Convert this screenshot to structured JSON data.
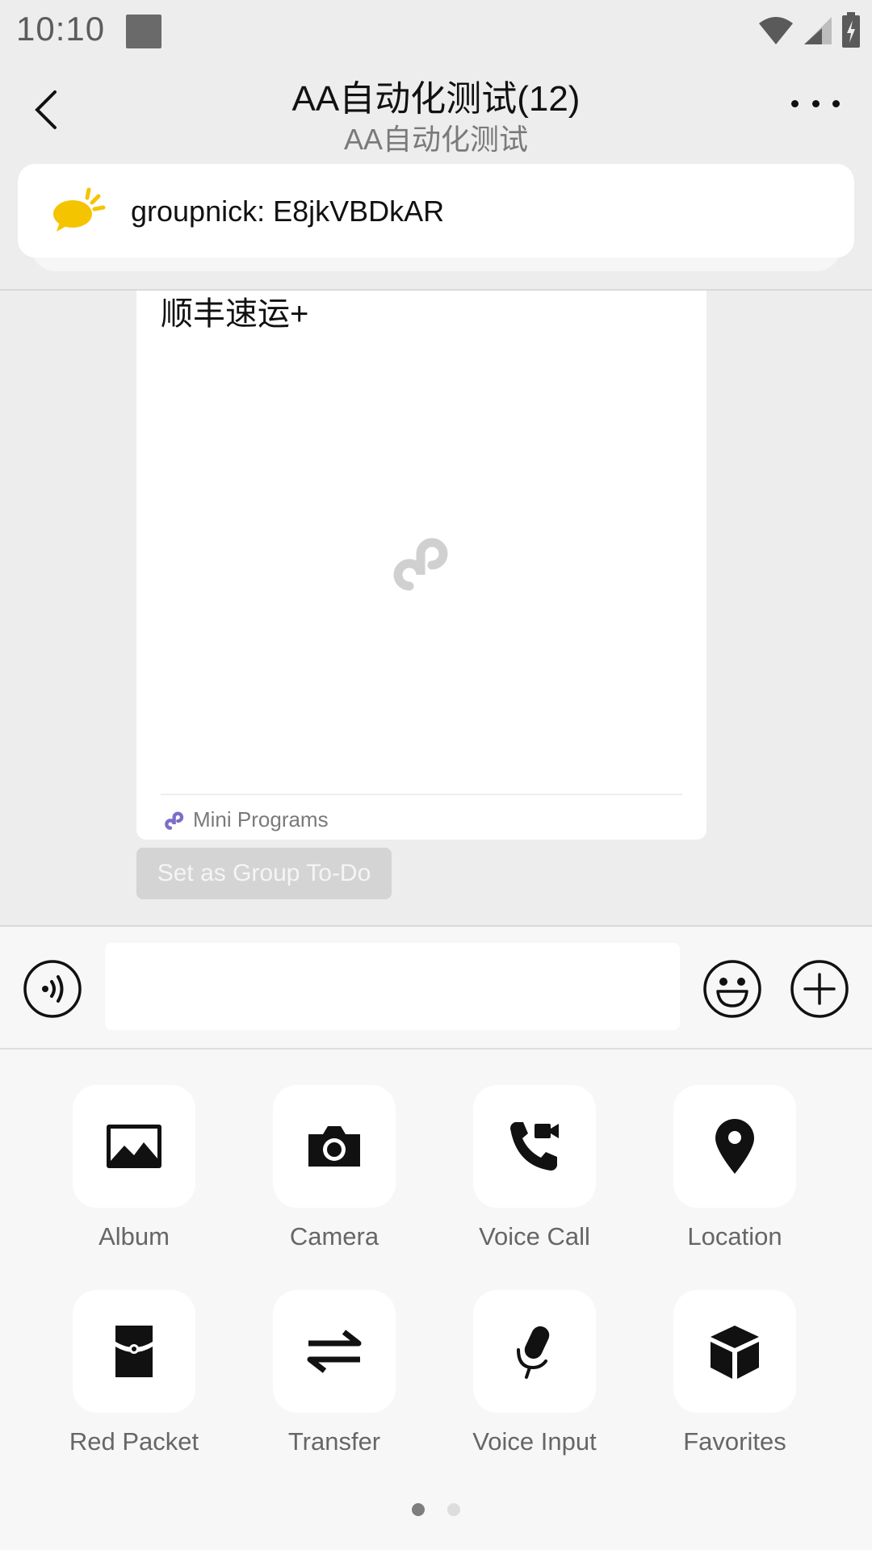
{
  "status_bar": {
    "time": "10:10"
  },
  "header": {
    "title": "AA自动化测试(12)",
    "subtitle": "AA自动化测试"
  },
  "announcement": {
    "text": "groupnick: E8jkVBDkAR"
  },
  "message_card": {
    "title": "顺丰速运+",
    "footer_label": "Mini Programs",
    "action_label": "Set as Group To-Do"
  },
  "input": {
    "value": "",
    "placeholder": ""
  },
  "functions": [
    {
      "label": "Album",
      "icon": "album-icon"
    },
    {
      "label": "Camera",
      "icon": "camera-icon"
    },
    {
      "label": "Voice Call",
      "icon": "voice-call-icon"
    },
    {
      "label": "Location",
      "icon": "location-icon"
    },
    {
      "label": "Red Packet",
      "icon": "red-packet-icon"
    },
    {
      "label": "Transfer",
      "icon": "transfer-icon"
    },
    {
      "label": "Voice Input",
      "icon": "microphone-icon"
    },
    {
      "label": "Favorites",
      "icon": "favorites-icon"
    }
  ],
  "pager": {
    "current": 1,
    "total": 2
  },
  "colors": {
    "accent_yellow": "#f5c400",
    "mini_program_purple": "#7b6fc7",
    "background": "#ededed"
  }
}
